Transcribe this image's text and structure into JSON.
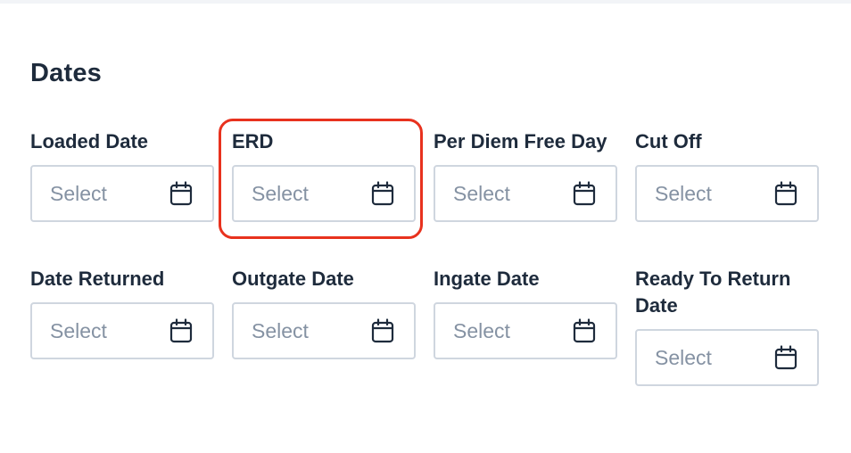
{
  "section": {
    "title": "Dates"
  },
  "fields": [
    {
      "label": "Loaded Date",
      "placeholder": "Select",
      "icon": "calendar-icon"
    },
    {
      "label": "ERD",
      "placeholder": "Select",
      "icon": "calendar-icon"
    },
    {
      "label": "Per Diem Free Day",
      "placeholder": "Select",
      "icon": "calendar-icon"
    },
    {
      "label": "Cut Off",
      "placeholder": "Select",
      "icon": "calendar-icon"
    },
    {
      "label": "Date Returned",
      "placeholder": "Select",
      "icon": "calendar-icon"
    },
    {
      "label": "Outgate Date",
      "placeholder": "Select",
      "icon": "calendar-icon"
    },
    {
      "label": "Ingate Date",
      "placeholder": "Select",
      "icon": "calendar-icon"
    },
    {
      "label": "Ready To Return Date",
      "placeholder": "Select",
      "icon": "calendar-icon"
    }
  ],
  "colors": {
    "highlight": "#e8321e",
    "border": "#cfd6df",
    "placeholder": "#8592a3",
    "text": "#1e2b3c"
  }
}
